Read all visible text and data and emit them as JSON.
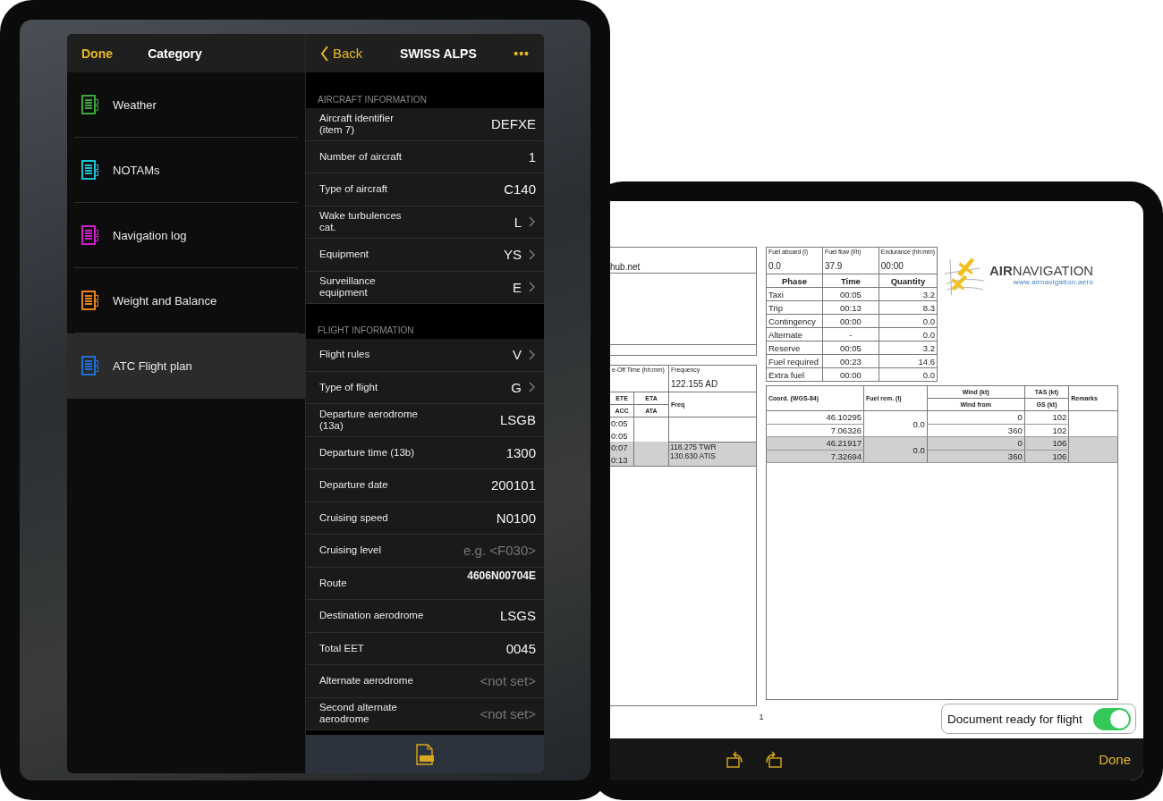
{
  "left_tablet": {
    "category_pane": {
      "done_button": "Done",
      "title": "Category",
      "items": [
        {
          "label": "Weather",
          "color": "#3aa83a",
          "selected": false
        },
        {
          "label": "NOTAMs",
          "color": "#19c3d6",
          "selected": false
        },
        {
          "label": "Navigation log",
          "color": "#d01ec8",
          "selected": false
        },
        {
          "label": "Weight and Balance",
          "color": "#e8841a",
          "selected": false
        },
        {
          "label": "ATC Flight plan",
          "color": "#1f6fd8",
          "selected": true
        }
      ]
    },
    "detail_pane": {
      "back_button": "Back",
      "title": "SWISS ALPS",
      "more_button": "•••",
      "sections": [
        {
          "header": "AIRCRAFT INFORMATION",
          "rows": [
            {
              "label": "Aircraft identifier\n(item 7)",
              "value": "DEFXE",
              "kind": "text"
            },
            {
              "label": "Number of aircraft",
              "value": "1",
              "kind": "text"
            },
            {
              "label": "Type of aircraft",
              "value": "C140",
              "kind": "text"
            },
            {
              "label": "Wake turbulences\ncat.",
              "value": "L",
              "kind": "picker"
            },
            {
              "label": "Equipment",
              "value": "YS",
              "kind": "picker"
            },
            {
              "label": "Surveillance\nequipment",
              "value": "E",
              "kind": "picker"
            }
          ]
        },
        {
          "header": "FLIGHT INFORMATION",
          "rows": [
            {
              "label": "Flight rules",
              "value": "V",
              "kind": "picker"
            },
            {
              "label": "Type of flight",
              "value": "G",
              "kind": "picker"
            },
            {
              "label": "Departure aerodrome\n(13a)",
              "value": "LSGB",
              "kind": "text"
            },
            {
              "label": "Departure time (13b)",
              "value": "1300",
              "kind": "text"
            },
            {
              "label": "Departure date",
              "value": "200101",
              "kind": "text"
            },
            {
              "label": "Cruising speed",
              "value": "N0100",
              "kind": "text"
            },
            {
              "label": "Cruising level",
              "placeholder": "e.g. <F030>",
              "kind": "text"
            },
            {
              "label": "Route",
              "value": "4606N00704E",
              "kind": "long"
            },
            {
              "label": "Destination aerodrome",
              "value": "LSGS",
              "kind": "text"
            },
            {
              "label": "Total EET",
              "value": "0045",
              "kind": "text"
            },
            {
              "label": "Alternate aerodrome",
              "placeholder": "<not set>",
              "kind": "text"
            },
            {
              "label": "Second alternate\naerodrome",
              "placeholder": "<not set>",
              "kind": "text"
            }
          ]
        }
      ]
    }
  },
  "right_tablet": {
    "document": {
      "contact_box": {
        "text": "hub.net"
      },
      "leg_table": {
        "takeoff_label": "e-Off Time (hh:mm)",
        "frequency_label": "Frequency",
        "frequency": "122.155 AD",
        "headers": {
          "ete": "ETE",
          "acc": "ACC",
          "eta": "ETA",
          "ata": "ATA",
          "freq": "Freq"
        },
        "rows": [
          {
            "shaded": false,
            "ete": "0:05",
            "acc": "0:05"
          },
          {
            "shaded": true,
            "ete": "0:07",
            "acc": "0:13",
            "freqs": [
              "118.275 TWR",
              "130.630 ATIS"
            ]
          }
        ]
      },
      "fuel_table": {
        "top": [
          {
            "label": "Fuel aboard (l)",
            "value": "0.0"
          },
          {
            "label": "Fuel flow (l/h)",
            "value": "37.9"
          },
          {
            "label": "Endurance (hh:mm)",
            "value": "00:00"
          }
        ],
        "columns": [
          "Phase",
          "Time",
          "Quantity"
        ],
        "rows": [
          [
            "Taxi",
            "00:05",
            "3.2"
          ],
          [
            "Trip",
            "00:13",
            "8.3"
          ],
          [
            "Contingency",
            "00:00",
            "0.0"
          ],
          [
            "Alternate",
            "-",
            "0.0"
          ],
          [
            "Reserve",
            "00:05",
            "3.2"
          ],
          [
            "Fuel required",
            "00:23",
            "14.6"
          ],
          [
            "Extra fuel",
            "00:00",
            "0.0"
          ]
        ]
      },
      "logo": {
        "name_bold": "AIR",
        "name_light": "NAVIGATION",
        "url": "www.airnavigation.aero"
      },
      "nav_table": {
        "headers": {
          "coord": "Coord. (WGS-84)",
          "fuel_rem": "Fuel rem. (l)",
          "wind": "Wind (kt)",
          "wind_from": "Wind from",
          "tas": "TAS (kt)",
          "gs": "GS (kt)",
          "remarks": "Remarks"
        },
        "rows": [
          {
            "shaded": false,
            "lat": "46.10295",
            "lon": "7.06326",
            "fuel_rem": "0.0",
            "wind": "0",
            "wind_from": "360",
            "tas": "102",
            "gs": "102"
          },
          {
            "shaded": true,
            "lat": "46.21917",
            "lon": "7.32694",
            "fuel_rem": "0.0",
            "wind": "0",
            "wind_from": "360",
            "tas": "106",
            "gs": "106"
          }
        ]
      },
      "page_number": "1"
    },
    "ready_toggle": {
      "label": "Document ready for flight",
      "on": true
    },
    "toolbar": {
      "done_button": "Done"
    }
  }
}
